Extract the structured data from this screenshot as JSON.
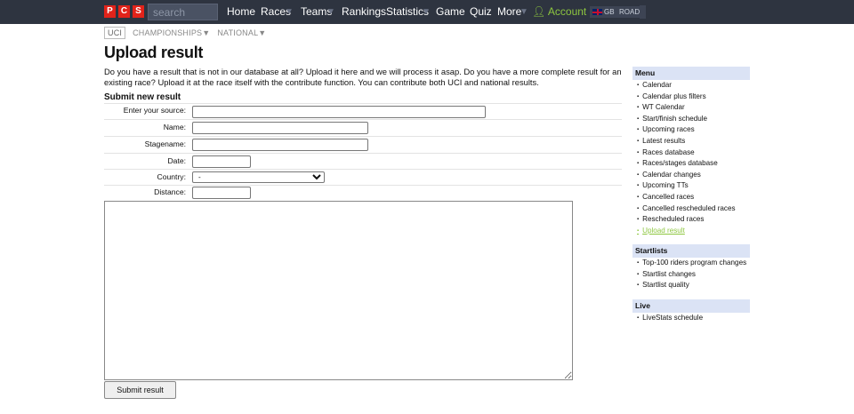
{
  "brand": {
    "logo_letters": [
      "P",
      "C",
      "S"
    ],
    "accent": "#e2231a"
  },
  "search": {
    "placeholder": "search"
  },
  "nav": {
    "items": [
      "Home",
      "Races",
      "Teams",
      "Rankings",
      "Statistics",
      "Game",
      "Quiz",
      "More"
    ],
    "account": "Account",
    "region": "GB",
    "discipline": "ROAD"
  },
  "subtabs": [
    "UCI",
    "CHAMPIONSHIPS▼",
    "NATIONAL▼"
  ],
  "page": {
    "title": "Upload result",
    "intro": "Do you have a result that is not in our database at all? Upload it here and we will process it asap. Do you have a more complete result for an existing race? Upload it at the race itself with the contribute function. You can contribute both UCI and national results."
  },
  "form": {
    "title": "Submit new result",
    "labels": {
      "source": "Enter your source:",
      "name": "Name:",
      "stagename": "Stagename:",
      "date": "Date:",
      "country": "Country:",
      "distance": "Distance:"
    },
    "country_selected": "-",
    "submit_label": "Submit result"
  },
  "sidebar": {
    "menu": {
      "title": "Menu",
      "items": [
        "Calendar",
        "Calendar plus filters",
        "WT Calendar",
        "Start/finish schedule",
        "Upcoming races",
        "Latest results",
        "Races database",
        "Races/stages database",
        "Calendar changes",
        "Upcoming TTs",
        "Cancelled races",
        "Cancelled rescheduled races",
        "Rescheduled races",
        "Upload result"
      ]
    },
    "startlists": {
      "title": "Startlists",
      "items": [
        "Top-100 riders program changes",
        "Startlist changes",
        "Startlist quality"
      ]
    },
    "live": {
      "title": "Live",
      "items": [
        "LiveStats schedule"
      ]
    }
  },
  "colors": {
    "topbar": "#2e3440",
    "account": "#8dc63f",
    "sidebar_header": "#dbe3f5"
  }
}
